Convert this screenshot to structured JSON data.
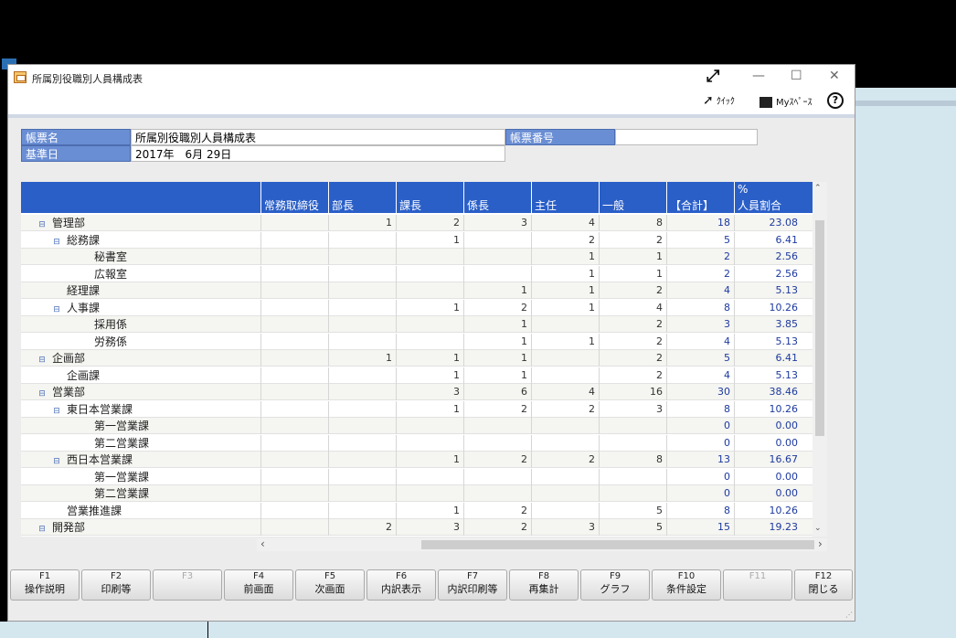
{
  "window": {
    "title": "所属別役職別人員構成表",
    "quick_label": "ｸｲｯｸ",
    "myspace_label": "Myｽﾍﾟｰｽ",
    "help_label": "?"
  },
  "info": {
    "report_name_label": "帳票名",
    "report_name_value": "所属別役職別人員構成表",
    "report_no_label": "帳票番号",
    "report_no_value": "",
    "base_date_label": "基準日",
    "base_date_value": "2017年　6月 29日"
  },
  "columns": [
    "常務取締役",
    "部長",
    "課長",
    "係長",
    "主任",
    "一般",
    "【合計】",
    "人員割合"
  ],
  "columns_top": [
    "",
    "",
    "",
    "",
    "",
    "",
    "",
    "%"
  ],
  "rows": [
    {
      "name": "管理部",
      "indent": 0,
      "toggle": true,
      "cells": [
        "",
        "1",
        "2",
        "3",
        "4",
        "8",
        "18",
        "23.08"
      ]
    },
    {
      "name": "総務課",
      "indent": 1,
      "toggle": true,
      "cells": [
        "",
        "",
        "1",
        "",
        "2",
        "2",
        "5",
        "6.41"
      ]
    },
    {
      "name": "秘書室",
      "indent": 2,
      "toggle": false,
      "cells": [
        "",
        "",
        "",
        "",
        "1",
        "1",
        "2",
        "2.56"
      ]
    },
    {
      "name": "広報室",
      "indent": 2,
      "toggle": false,
      "cells": [
        "",
        "",
        "",
        "",
        "1",
        "1",
        "2",
        "2.56"
      ]
    },
    {
      "name": "経理課",
      "indent": 1,
      "toggle": false,
      "cells": [
        "",
        "",
        "",
        "1",
        "1",
        "2",
        "4",
        "5.13"
      ]
    },
    {
      "name": "人事課",
      "indent": 1,
      "toggle": true,
      "cells": [
        "",
        "",
        "1",
        "2",
        "1",
        "4",
        "8",
        "10.26"
      ]
    },
    {
      "name": "採用係",
      "indent": 2,
      "toggle": false,
      "cells": [
        "",
        "",
        "",
        "1",
        "",
        "2",
        "3",
        "3.85"
      ]
    },
    {
      "name": "労務係",
      "indent": 2,
      "toggle": false,
      "cells": [
        "",
        "",
        "",
        "1",
        "1",
        "2",
        "4",
        "5.13"
      ]
    },
    {
      "name": "企画部",
      "indent": 0,
      "toggle": true,
      "cells": [
        "",
        "1",
        "1",
        "1",
        "",
        "2",
        "5",
        "6.41"
      ]
    },
    {
      "name": "企画課",
      "indent": 1,
      "toggle": false,
      "cells": [
        "",
        "",
        "1",
        "1",
        "",
        "2",
        "4",
        "5.13"
      ]
    },
    {
      "name": "営業部",
      "indent": 0,
      "toggle": true,
      "cells": [
        "",
        "",
        "3",
        "6",
        "4",
        "16",
        "30",
        "38.46"
      ]
    },
    {
      "name": "東日本営業課",
      "indent": 1,
      "toggle": true,
      "cells": [
        "",
        "",
        "1",
        "2",
        "2",
        "3",
        "8",
        "10.26"
      ]
    },
    {
      "name": "第一営業課",
      "indent": 2,
      "toggle": false,
      "cells": [
        "",
        "",
        "",
        "",
        "",
        "",
        "0",
        "0.00"
      ]
    },
    {
      "name": "第二営業課",
      "indent": 2,
      "toggle": false,
      "cells": [
        "",
        "",
        "",
        "",
        "",
        "",
        "0",
        "0.00"
      ]
    },
    {
      "name": "西日本営業課",
      "indent": 1,
      "toggle": true,
      "cells": [
        "",
        "",
        "1",
        "2",
        "2",
        "8",
        "13",
        "16.67"
      ]
    },
    {
      "name": "第一営業課",
      "indent": 2,
      "toggle": false,
      "cells": [
        "",
        "",
        "",
        "",
        "",
        "",
        "0",
        "0.00"
      ]
    },
    {
      "name": "第二営業課",
      "indent": 2,
      "toggle": false,
      "cells": [
        "",
        "",
        "",
        "",
        "",
        "",
        "0",
        "0.00"
      ]
    },
    {
      "name": "営業推進課",
      "indent": 1,
      "toggle": false,
      "cells": [
        "",
        "",
        "1",
        "2",
        "",
        "5",
        "8",
        "10.26"
      ]
    },
    {
      "name": "開発部",
      "indent": 0,
      "toggle": true,
      "cells": [
        "",
        "2",
        "3",
        "2",
        "3",
        "5",
        "15",
        "19.23"
      ]
    }
  ],
  "fkeys": [
    {
      "key": "F1",
      "label": "操作説明",
      "enabled": true
    },
    {
      "key": "F2",
      "label": "印刷等",
      "enabled": true
    },
    {
      "key": "F3",
      "label": "",
      "enabled": false
    },
    {
      "key": "F4",
      "label": "前画面",
      "enabled": true
    },
    {
      "key": "F5",
      "label": "次画面",
      "enabled": true
    },
    {
      "key": "F6",
      "label": "内訳表示",
      "enabled": true
    },
    {
      "key": "F7",
      "label": "内訳印刷等",
      "enabled": true
    },
    {
      "key": "F8",
      "label": "再集計",
      "enabled": true
    },
    {
      "key": "F9",
      "label": "グラフ",
      "enabled": true
    },
    {
      "key": "F10",
      "label": "条件設定",
      "enabled": true
    },
    {
      "key": "F11",
      "label": "",
      "enabled": false
    },
    {
      "key": "F12",
      "label": "閉じる",
      "enabled": true
    }
  ]
}
